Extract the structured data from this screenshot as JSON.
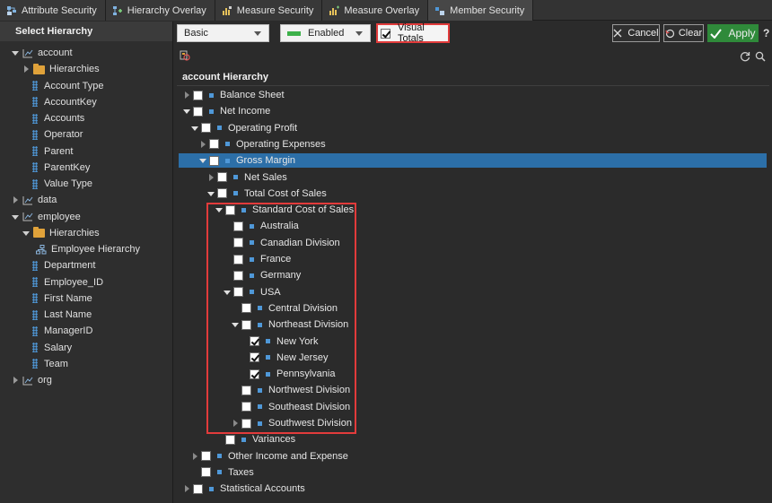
{
  "tabs": [
    {
      "label": "Attribute Security",
      "icon": "attribute-security-icon",
      "active": false
    },
    {
      "label": "Hierarchy Overlay",
      "icon": "hierarchy-overlay-icon",
      "active": false
    },
    {
      "label": "Measure Security",
      "icon": "measure-security-icon",
      "active": false
    },
    {
      "label": "Measure Overlay",
      "icon": "measure-overlay-icon",
      "active": false
    },
    {
      "label": "Member Security",
      "icon": "member-security-icon",
      "active": true
    }
  ],
  "left_panel": {
    "title": "Select Hierarchy",
    "items": [
      {
        "label": "account",
        "type": "dimension",
        "caret": "down",
        "indent": 0
      },
      {
        "label": "Hierarchies",
        "type": "folder",
        "caret": "right",
        "indent": 1
      },
      {
        "label": "Account Type",
        "type": "level",
        "caret": "",
        "indent": 1
      },
      {
        "label": "AccountKey",
        "type": "level",
        "caret": "",
        "indent": 1
      },
      {
        "label": "Accounts",
        "type": "level",
        "caret": "",
        "indent": 1
      },
      {
        "label": "Operator",
        "type": "level",
        "caret": "",
        "indent": 1
      },
      {
        "label": "Parent",
        "type": "level",
        "caret": "",
        "indent": 1
      },
      {
        "label": "ParentKey",
        "type": "level",
        "caret": "",
        "indent": 1
      },
      {
        "label": "Value Type",
        "type": "level",
        "caret": "",
        "indent": 1
      },
      {
        "label": "data",
        "type": "dimension",
        "caret": "right",
        "indent": 0
      },
      {
        "label": "employee",
        "type": "dimension",
        "caret": "down",
        "indent": 0
      },
      {
        "label": "Hierarchies",
        "type": "folder",
        "caret": "down",
        "indent": 1
      },
      {
        "label": "Employee Hierarchy",
        "type": "hierarchy",
        "caret": "",
        "indent": 2
      },
      {
        "label": "Department",
        "type": "level",
        "caret": "",
        "indent": 1
      },
      {
        "label": "Employee_ID",
        "type": "level",
        "caret": "",
        "indent": 1
      },
      {
        "label": "First Name",
        "type": "level",
        "caret": "",
        "indent": 1
      },
      {
        "label": "Last Name",
        "type": "level",
        "caret": "",
        "indent": 1
      },
      {
        "label": "ManagerID",
        "type": "level",
        "caret": "",
        "indent": 1
      },
      {
        "label": "Salary",
        "type": "level",
        "caret": "",
        "indent": 1
      },
      {
        "label": "Team",
        "type": "level",
        "caret": "",
        "indent": 1
      },
      {
        "label": "org",
        "type": "dimension",
        "caret": "right",
        "indent": 0
      }
    ]
  },
  "toolbar": {
    "mode_select": "Basic",
    "state_select": "Enabled",
    "visual_totals_label": "Visual Totals",
    "visual_totals_checked": true,
    "cancel_label": "Cancel",
    "clear_label": "Clear",
    "apply_label": "Apply",
    "help_label": "?"
  },
  "tree": {
    "header": "account Hierarchy",
    "rows": [
      {
        "label": "Balance Sheet",
        "depth": 0,
        "caret": "right",
        "checked": false,
        "selected": false
      },
      {
        "label": "Net Income",
        "depth": 0,
        "caret": "down",
        "checked": false,
        "selected": false
      },
      {
        "label": "Operating Profit",
        "depth": 1,
        "caret": "down",
        "checked": false,
        "selected": false
      },
      {
        "label": "Operating Expenses",
        "depth": 2,
        "caret": "right",
        "checked": false,
        "selected": false
      },
      {
        "label": "Gross Margin",
        "depth": 2,
        "caret": "down",
        "checked": false,
        "selected": true
      },
      {
        "label": "Net Sales",
        "depth": 3,
        "caret": "right",
        "checked": false,
        "selected": false
      },
      {
        "label": "Total Cost of Sales",
        "depth": 3,
        "caret": "down",
        "checked": false,
        "selected": false
      },
      {
        "label": "Standard Cost of Sales",
        "depth": 4,
        "caret": "down",
        "checked": false,
        "selected": false
      },
      {
        "label": "Australia",
        "depth": 5,
        "caret": "",
        "checked": false,
        "selected": false
      },
      {
        "label": "Canadian Division",
        "depth": 5,
        "caret": "",
        "checked": false,
        "selected": false
      },
      {
        "label": "France",
        "depth": 5,
        "caret": "",
        "checked": false,
        "selected": false
      },
      {
        "label": "Germany",
        "depth": 5,
        "caret": "",
        "checked": false,
        "selected": false
      },
      {
        "label": "USA",
        "depth": 5,
        "caret": "down",
        "checked": false,
        "selected": false
      },
      {
        "label": "Central Division",
        "depth": 6,
        "caret": "",
        "checked": false,
        "selected": false
      },
      {
        "label": "Northeast Division",
        "depth": 6,
        "caret": "down",
        "checked": false,
        "selected": false
      },
      {
        "label": "New York",
        "depth": 7,
        "caret": "",
        "checked": true,
        "selected": false
      },
      {
        "label": "New Jersey",
        "depth": 7,
        "caret": "",
        "checked": true,
        "selected": false
      },
      {
        "label": "Pennsylvania",
        "depth": 7,
        "caret": "",
        "checked": true,
        "selected": false
      },
      {
        "label": "Northwest Division",
        "depth": 6,
        "caret": "",
        "checked": false,
        "selected": false
      },
      {
        "label": "Southeast Division",
        "depth": 6,
        "caret": "",
        "checked": false,
        "selected": false
      },
      {
        "label": "Southwest Division",
        "depth": 6,
        "caret": "right",
        "checked": false,
        "selected": false
      },
      {
        "label": "Variances",
        "depth": 4,
        "caret": "",
        "checked": false,
        "selected": false
      },
      {
        "label": "Other Income and Expense",
        "depth": 1,
        "caret": "right",
        "checked": false,
        "selected": false
      },
      {
        "label": "Taxes",
        "depth": 1,
        "caret": "",
        "checked": false,
        "selected": false
      },
      {
        "label": "Statistical Accounts",
        "depth": 0,
        "caret": "right",
        "checked": false,
        "selected": false
      }
    ]
  },
  "colors": {
    "accent_selection": "#2c6fa8",
    "apply_green": "#2f8a3a",
    "highlight_red": "#e23b3b",
    "member_blue": "#4f98d8"
  }
}
